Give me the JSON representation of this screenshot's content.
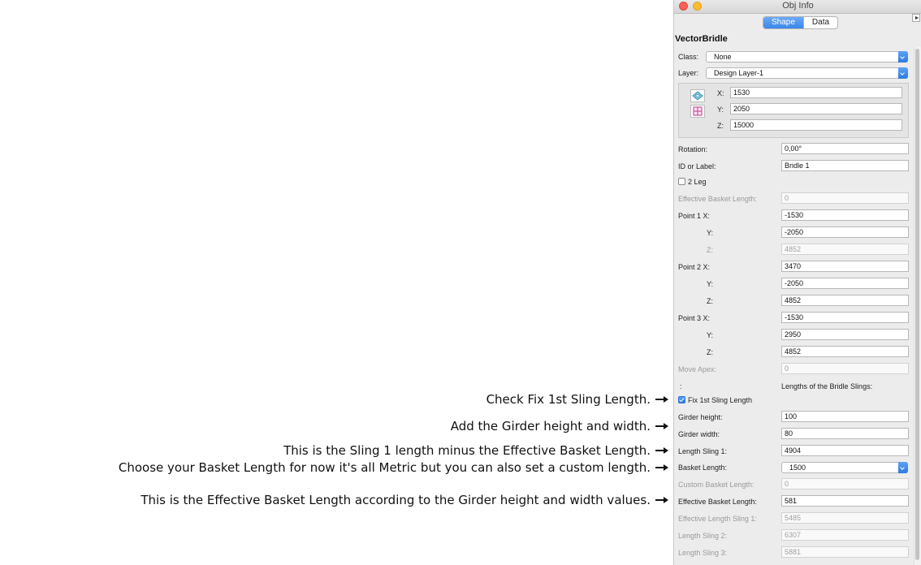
{
  "window": {
    "title": "Obj Info"
  },
  "tabs": [
    "Shape",
    "Data"
  ],
  "object_name": "VectorBridle",
  "class": {
    "label": "Class:",
    "value": "None"
  },
  "layer": {
    "label": "Layer:",
    "value": "Design Layer-1"
  },
  "coords": {
    "x_label": "X:",
    "x": "1530",
    "y_label": "Y:",
    "y": "2050",
    "z_label": "Z:",
    "z": "15000"
  },
  "rotation": {
    "label": "Rotation:",
    "value": "0,00°"
  },
  "id_label": {
    "label": "ID or Label:",
    "value": "Bridle 1"
  },
  "two_leg": {
    "label": "2 Leg",
    "checked": false
  },
  "effective_basket_top": {
    "label": "Effective Basket Length:",
    "value": "0"
  },
  "point1": {
    "x_label": "Point 1 X:",
    "x": "-1530",
    "y_label": "Y:",
    "y": "-2050",
    "z_label": "Z:",
    "z": "4852"
  },
  "point2": {
    "x_label": "Point 2 X:",
    "x": "3470",
    "y_label": "Y:",
    "y": "-2050",
    "z_label": "Z:",
    "z": "4852"
  },
  "point3": {
    "x_label": "Point 3 X:",
    "x": "-1530",
    "y_label": "Y:",
    "y": "2950",
    "z_label": "Z:",
    "z": "4852"
  },
  "move_apex": {
    "label": "Move Apex:",
    "value": "0"
  },
  "colon_label": ":",
  "lengths_heading": "Lengths of the Bridle Slings:",
  "fix_sling": {
    "label": "Fix 1st Sling Length",
    "checked": true
  },
  "girder_height": {
    "label": "Girder height:",
    "value": "100"
  },
  "girder_width": {
    "label": "Girder width:",
    "value": "80"
  },
  "length_sling1": {
    "label": "Length Sling 1:",
    "value": "4904"
  },
  "basket_length": {
    "label": "Basket Length:",
    "value": "1500"
  },
  "custom_basket": {
    "label": "Custom Basket Length:",
    "value": "0"
  },
  "effective_basket": {
    "label": "Effective Basket Length:",
    "value": "581"
  },
  "effective_sling1": {
    "label": "Effective Length Sling 1:",
    "value": "5485"
  },
  "length_sling2": {
    "label": "Length Sling 2:",
    "value": "6307"
  },
  "length_sling3": {
    "label": "Length Sling 3:",
    "value": "5881"
  },
  "annotations": {
    "fix": "Check Fix 1st Sling Length.",
    "girder": "Add the Girder height and width.",
    "sling1": "This is the Sling 1 length minus the Effective Basket Length.",
    "basket": "Choose your Basket Length for now it's all Metric but you can also set a custom length.",
    "effective": "This is the Effective Basket Length according to the Girder height and width values."
  },
  "colors": {
    "accent": "#3c86ea",
    "close": "#fc5f57",
    "minimize": "#fdbc2e"
  }
}
